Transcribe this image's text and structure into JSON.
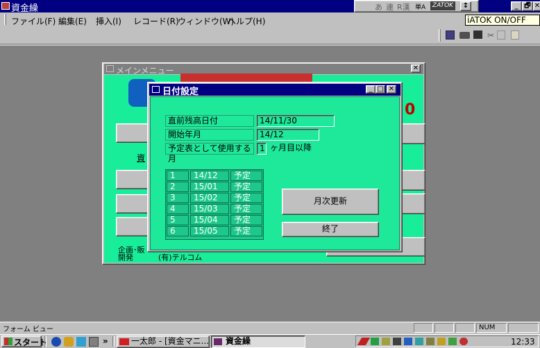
{
  "app": {
    "title": "資金繰"
  },
  "title_controls": {
    "minimize": "_",
    "maximize": "🗗",
    "close": "✕"
  },
  "ime_bar": {
    "items": [
      "あ",
      "連",
      "R漢",
      "単A",
      "ZATOK"
    ],
    "tooltip": "iATOK ON/OFF"
  },
  "menu": [
    {
      "label": "ファイル(F)"
    },
    {
      "label": "編集(E)"
    },
    {
      "label": "挿入(I)"
    },
    {
      "label": "レコード(R)"
    },
    {
      "label": "ウィンドウ(W)"
    },
    {
      "label": "ヘルプ(H)"
    }
  ],
  "main_menu": {
    "title": "メインメニュー",
    "heading_digit": "0",
    "button_label": "資",
    "footer_line1": "企画･販",
    "footer_line2": "開発",
    "footer_company": "(有)テルコム"
  },
  "dialog": {
    "title": "日付設定",
    "fields": [
      {
        "label": "直前残高日付",
        "value": "14/11/30"
      },
      {
        "label": "開始年月",
        "value": "14/12"
      },
      {
        "label": "予定表として使用する月",
        "value": "1",
        "suffix": "ヶ月目以降"
      }
    ],
    "schedule": [
      {
        "no": "1",
        "month": "14/12",
        "type": "予定"
      },
      {
        "no": "2",
        "month": "15/01",
        "type": "予定"
      },
      {
        "no": "3",
        "month": "15/02",
        "type": "予定"
      },
      {
        "no": "4",
        "month": "15/03",
        "type": "予定"
      },
      {
        "no": "5",
        "month": "15/04",
        "type": "予定"
      },
      {
        "no": "6",
        "month": "15/05",
        "type": "予定"
      }
    ],
    "update_button": "月次更新",
    "close_button": "終了"
  },
  "status": {
    "left": "フォーム ビュー",
    "num": "NUM"
  },
  "taskbar": {
    "start": "スタート",
    "chevron": "»",
    "tasks": [
      "一太郎 - [資金マニ...",
      "資金繰"
    ],
    "clock": "12:33"
  },
  "colors": {
    "form_green": "#1ee89a",
    "title_blue": "#000080"
  }
}
